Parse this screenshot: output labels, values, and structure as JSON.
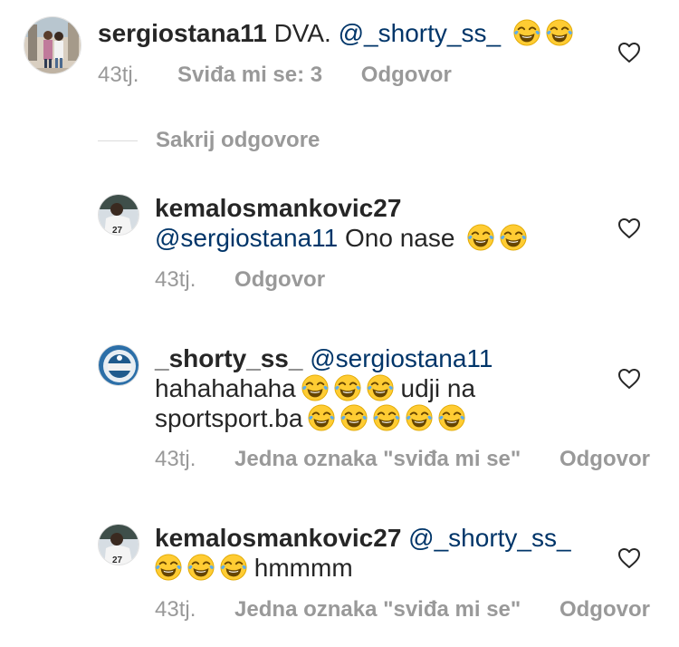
{
  "comments": [
    {
      "username": "sergiostana11",
      "text": "DVA.",
      "mention": "@_shorty_ss_",
      "time": "43tj.",
      "likes": "Sviđa mi se: 3",
      "reply": "Odgovor"
    },
    {
      "username": "kemalosmankovic27",
      "mention": "@sergiostana11",
      "text": "Ono nase",
      "time": "43tj.",
      "reply": "Odgovor"
    },
    {
      "username": "_shorty_ss_",
      "mention": "@sergiostana11",
      "line2_text": "hahahahaha",
      "line2_suffix": "udji na",
      "line3_text": "sportsport.ba",
      "time": "43tj.",
      "likes": "Jedna oznaka \"sviđa mi se\"",
      "reply": "Odgovor"
    },
    {
      "username": "kemalosmankovic27",
      "mention": "@_shorty_ss_",
      "line2_text": "hmmmm",
      "time": "43tj.",
      "likes": "Jedna oznaka \"sviđa mi se\"",
      "reply": "Odgovor"
    }
  ],
  "replies_toggle": "Sakrij odgovore",
  "icons": {
    "like": "heart-outline-icon",
    "emoji": "tears-of-joy-emoji"
  },
  "colors": {
    "text": "#262626",
    "muted": "#999999",
    "mention": "#003569"
  }
}
